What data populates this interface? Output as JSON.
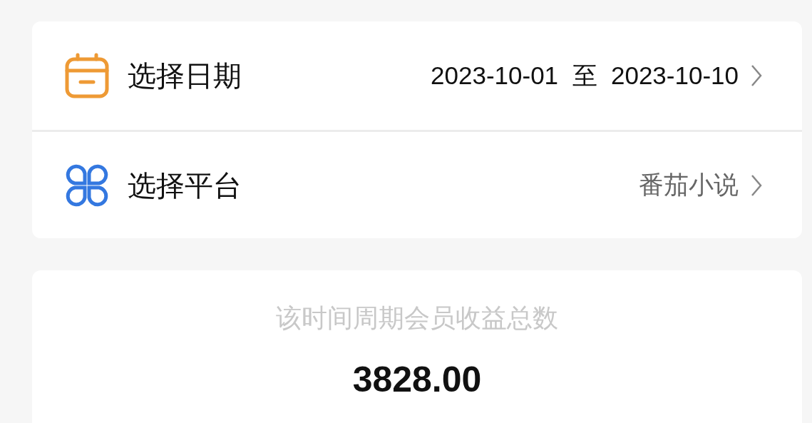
{
  "filters": [
    {
      "kind": "date",
      "label": "选择日期",
      "value": "2023-10-01  至  2023-10-10"
    },
    {
      "kind": "platform",
      "label": "选择平台",
      "value": "番茄小说"
    }
  ],
  "summary": {
    "label": "该时间周期会员收益总数",
    "value": "3828.00"
  }
}
